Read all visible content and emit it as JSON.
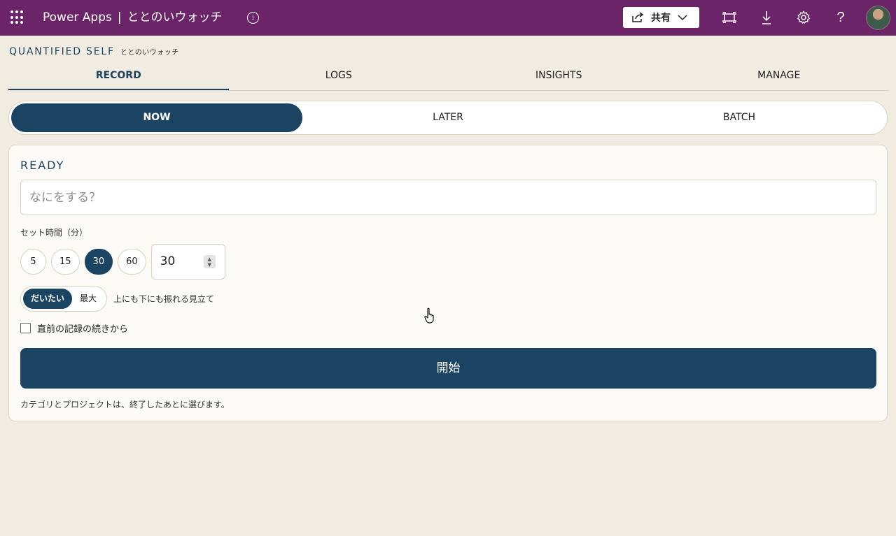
{
  "topbar": {
    "product": "Power Apps",
    "separator": "|",
    "app_name": "ととのいウォッチ",
    "share_label": "共有",
    "icons": [
      "waffle-icon",
      "info-icon",
      "share-icon",
      "chevron-down-icon",
      "fit-screen-icon",
      "download-icon",
      "gear-icon",
      "help-icon",
      "avatar"
    ],
    "bar_color": "#6b2468"
  },
  "header": {
    "title": "QUANTIFIED SELF",
    "subtitle": "ととのいウォッチ"
  },
  "tabs": [
    {
      "label": "RECORD",
      "active": true
    },
    {
      "label": "LOGS",
      "active": false
    },
    {
      "label": "INSIGHTS",
      "active": false
    },
    {
      "label": "MANAGE",
      "active": false
    }
  ],
  "modes": [
    {
      "label": "NOW",
      "active": true
    },
    {
      "label": "LATER",
      "active": false
    },
    {
      "label": "BATCH",
      "active": false
    }
  ],
  "card": {
    "title": "READY",
    "task_placeholder": "なにをする？",
    "task_value": "",
    "set_time_label": "セット時間（分）",
    "presets": [
      {
        "label": "5",
        "active": false
      },
      {
        "label": "15",
        "active": false
      },
      {
        "label": "30",
        "active": true
      },
      {
        "label": "60",
        "active": false
      }
    ],
    "minutes_value": "30",
    "estimate_modes": [
      {
        "label": "だいたい",
        "active": true
      },
      {
        "label": "最大",
        "active": false
      }
    ],
    "estimate_hint": "上にも下にも振れる見立て",
    "continue_label": "直前の記録の続きから",
    "continue_checked": false,
    "start_label": "開始",
    "footnote": "カテゴリとプロジェクトは、終了したあとに選びます。"
  },
  "colors": {
    "accent": "#1b4462",
    "background": "#f1ece2",
    "card": "#fcfaf6"
  }
}
